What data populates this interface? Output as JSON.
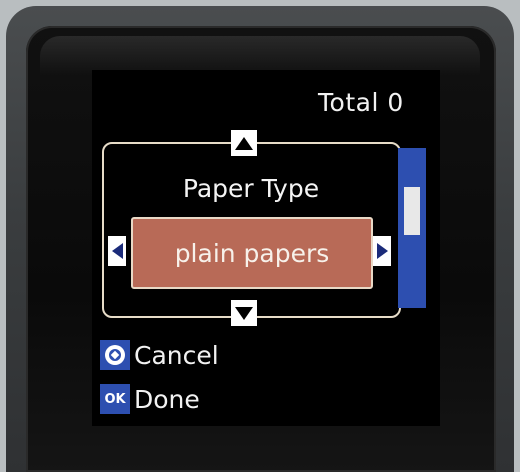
{
  "header": {
    "total_label": "Total 0"
  },
  "selector": {
    "title": "Paper Type",
    "value": "plain papers"
  },
  "scrollbar": {
    "position": 0.33
  },
  "softkeys": [
    {
      "icon": "stop-icon",
      "label": "Cancel"
    },
    {
      "icon_text": "OK",
      "label": "Done"
    }
  ],
  "colors": {
    "highlight": "#b86a57",
    "accent_blue": "#2d4fb0",
    "text": "#f2f2f2"
  }
}
